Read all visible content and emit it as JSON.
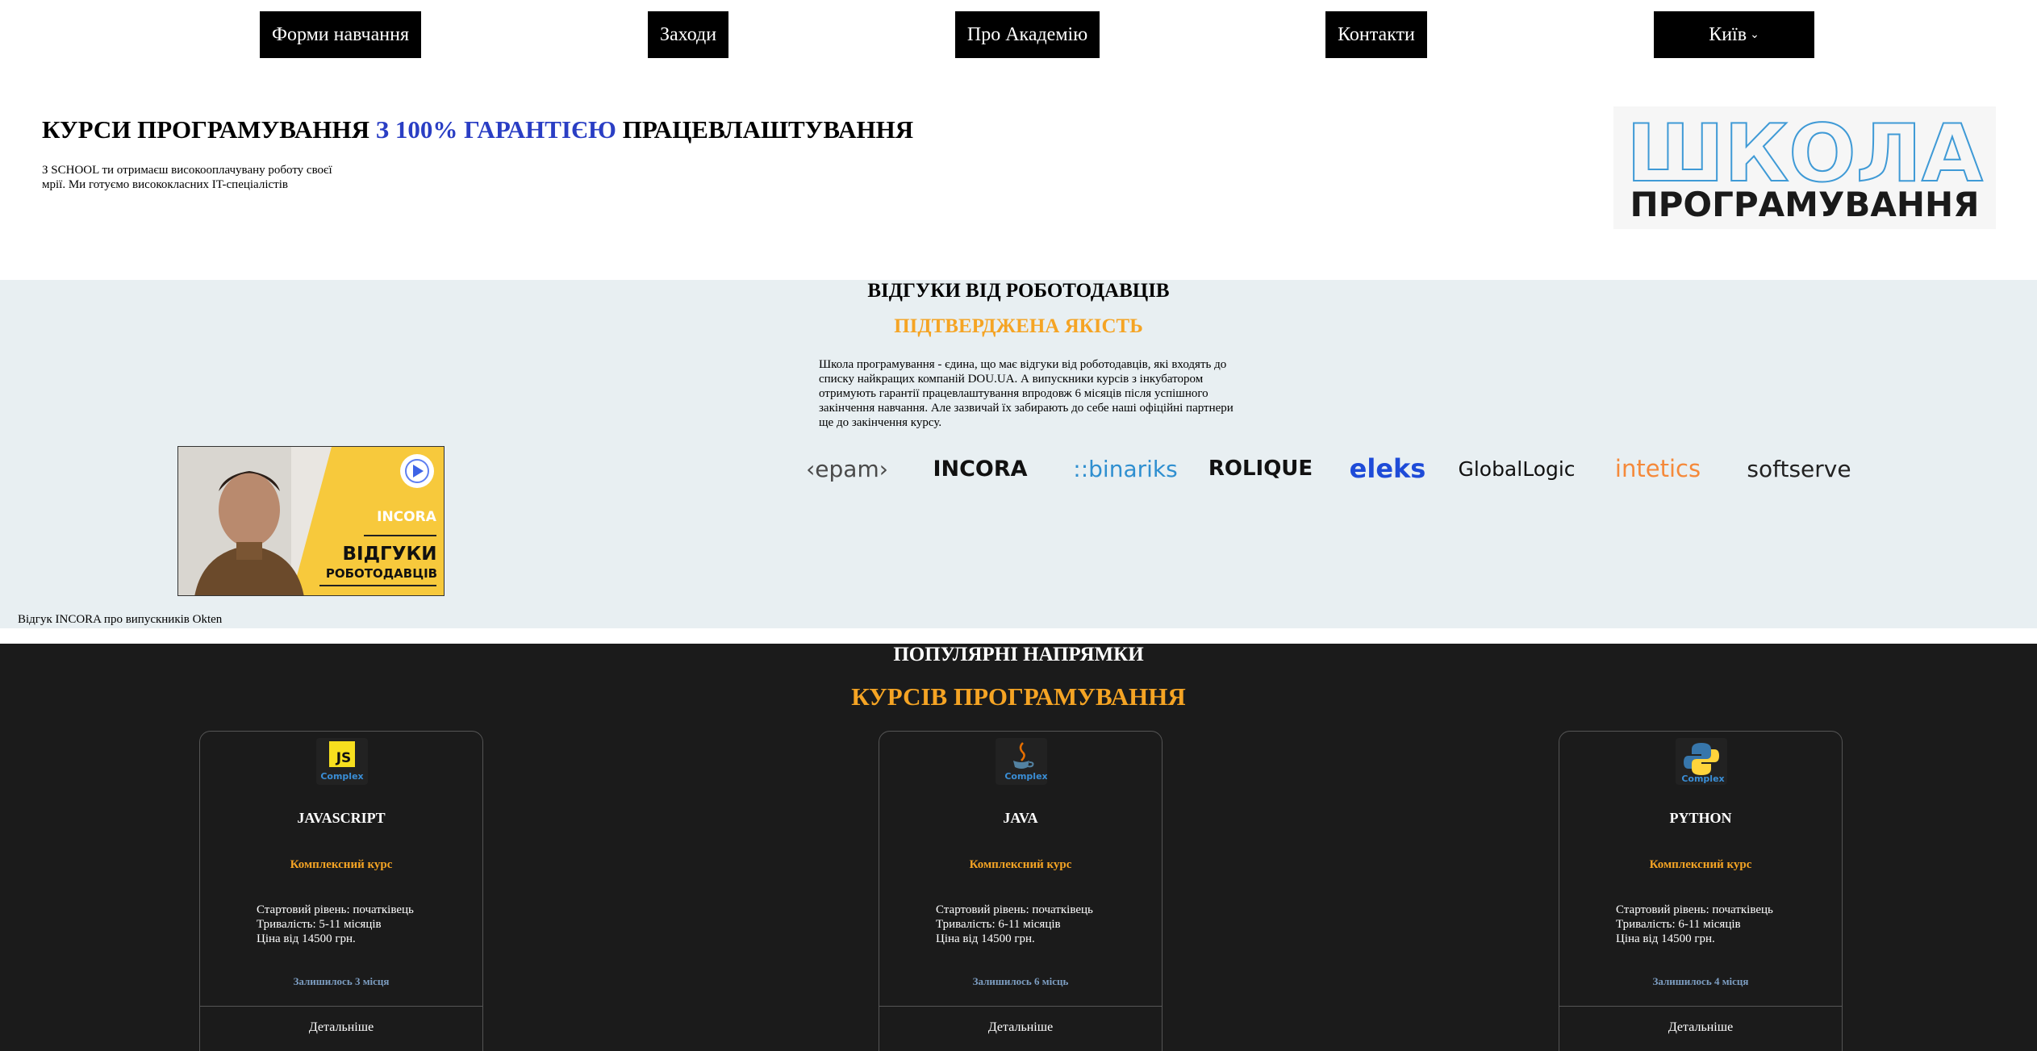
{
  "nav": {
    "items": [
      {
        "label": "Форми навчання"
      },
      {
        "label": "Заходи"
      },
      {
        "label": "Про Академію"
      },
      {
        "label": "Контакти"
      }
    ],
    "city": "Київ"
  },
  "hero": {
    "title_start": "КУРСИ ПРОГРАМУВАННЯ ",
    "title_accent": "З 100% ГАРАНТІЄЮ",
    "title_end": " ПРАЦЕВЛАШТУВАННЯ",
    "subtitle_line1": "З SCHOOL ти отримаєш високооплачувану роботу своєї",
    "subtitle_line2": "мрії. Ми готуємо висококласних IT-спеціалістів",
    "logo_top": "ШКОЛА",
    "logo_bottom": "ПРОГРАМУВАННЯ"
  },
  "reviews": {
    "title": "ВІДГУКИ ВІД РОБОТОДАВЦІВ",
    "subtitle": "ПІДТВЕРДЖЕНА ЯКІСТЬ",
    "text": "Школа програмування - єдина, що має відгуки від роботодавців, які входять до списку найкращих компаній DOU.UA. А випускники курсів з інкубатором отримують гарантії працевлаштування впродовж 6 місяців після успішного закінчення навчання. Але зазвичай їх забирають до себе наші офіційні партнери ще до закінчення курсу.",
    "video": {
      "brand": "INCORA",
      "line1": "ВІДГУКИ",
      "line2": "РОБОТОДАВЦІВ"
    },
    "video_caption": "Відгук INCORA про випускників Okten",
    "partners": [
      {
        "name": "‹epam›",
        "color": "#4a4a4a"
      },
      {
        "name": "INCORA",
        "color": "#111111"
      },
      {
        "name": "::binariks",
        "color": "#2f8fd0"
      },
      {
        "name": "ROLIQUE",
        "color": "#111111"
      },
      {
        "name": "eleks",
        "color": "#1e4bd8"
      },
      {
        "name": "GlobalLogic",
        "color": "#111111"
      },
      {
        "name": "intetics",
        "color": "#f5893a"
      },
      {
        "name": "softserve",
        "color": "#222222"
      }
    ]
  },
  "courses": {
    "title": "ПОПУЛЯРНІ НАПРЯМКИ",
    "subtitle": "КУРСІВ ПРОГРАМУВАННЯ",
    "items": [
      {
        "name": "JAVASCRIPT",
        "badge": "Complex",
        "icon": "js-icon",
        "type": "Комплексний курс",
        "level": "Стартовий рівень: початківець",
        "duration": "Тривалість: 5-11 місяців",
        "price": "Ціна від 14500 грн.",
        "seats": "Залишилось 3 місця",
        "more": "Детальніше"
      },
      {
        "name": "JAVA",
        "badge": "Complex",
        "icon": "java-icon",
        "type": "Комплексний курс",
        "level": "Стартовий рівень: початківець",
        "duration": "Тривалість: 6-11 місяців",
        "price": "Ціна від 14500 грн.",
        "seats": "Залишилось 6 місць",
        "more": "Детальніше"
      },
      {
        "name": "PYTHON",
        "badge": "Complex",
        "icon": "python-icon",
        "type": "Комплексний курс",
        "level": "Стартовий рівень: початківець",
        "duration": "Тривалість: 6-11 місяців",
        "price": "Ціна від 14500 грн.",
        "seats": "Залишилось 4 місця",
        "more": "Детальніше"
      }
    ]
  },
  "colors": {
    "accent_orange": "#f5a424",
    "accent_blue": "#2a3ec4",
    "reviews_bg": "#e8eff2",
    "courses_bg": "#1b1b1b"
  }
}
